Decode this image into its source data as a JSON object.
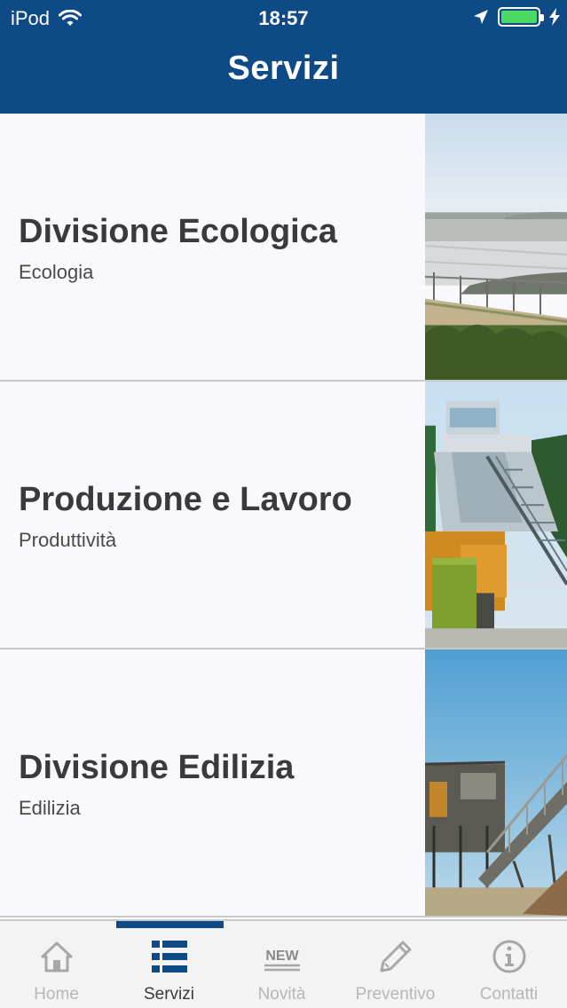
{
  "status_bar": {
    "carrier": "iPod",
    "time": "18:57",
    "wifi_icon": "wifi-icon",
    "location_icon": "location-arrow-icon",
    "charging_icon": "bolt-icon",
    "battery_color": "#4cd964"
  },
  "header": {
    "title": "Servizi",
    "background": "#0d4a86"
  },
  "services": [
    {
      "title": "Divisione Ecologica",
      "subtitle": "Ecologia"
    },
    {
      "title": "Produzione e Lavoro",
      "subtitle": "Produttività"
    },
    {
      "title": "Divisione Edilizia",
      "subtitle": "Edilizia"
    }
  ],
  "tabbar": {
    "active_index": 1,
    "tabs": [
      {
        "label": "Home",
        "icon": "home-icon"
      },
      {
        "label": "Servizi",
        "icon": "list-icon"
      },
      {
        "label": "Novità",
        "icon": "new-badge-icon",
        "badge_text": "NEW"
      },
      {
        "label": "Preventivo",
        "icon": "pencil-icon"
      },
      {
        "label": "Contatti",
        "icon": "info-icon"
      }
    ]
  }
}
